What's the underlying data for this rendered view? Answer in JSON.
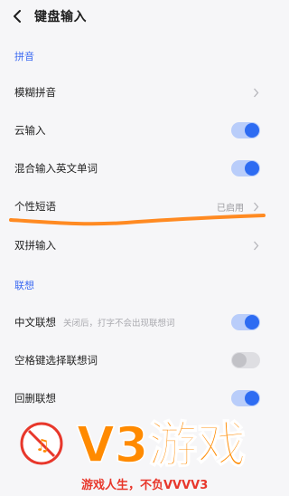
{
  "header": {
    "title": "键盘输入"
  },
  "sections": {
    "pinyin": "拼音",
    "lianxiang": "联想"
  },
  "rows": {
    "fuzzy": {
      "label": "模糊拼音"
    },
    "cloud": {
      "label": "云输入",
      "state": "on"
    },
    "mixed": {
      "label": "混合输入英文单词",
      "state": "on"
    },
    "phrase": {
      "label": "个性短语",
      "status": "已启用"
    },
    "shuangpin": {
      "label": "双拼输入"
    },
    "cn_lianxiang": {
      "label": "中文联想",
      "sub": "关闭后，打字不会出现联想词",
      "state": "on"
    },
    "space_select": {
      "label": "空格键选择联想词",
      "state": "off"
    },
    "delete_lianxiang": {
      "label": "回删联想",
      "state": "on"
    }
  },
  "icons": {
    "back": "back-arrow-icon",
    "chevron": "chevron-right-icon",
    "watermark_logo": "v3-logo-icon"
  },
  "watermark": {
    "brand_text": "V3游戏",
    "slogan": "游戏人生，不负VVVV3"
  },
  "colors": {
    "accent": "#3d6bf2",
    "annotation": "#ff8a22",
    "watermark_orange": "#ff8a00",
    "watermark_red": "#e8372b"
  }
}
